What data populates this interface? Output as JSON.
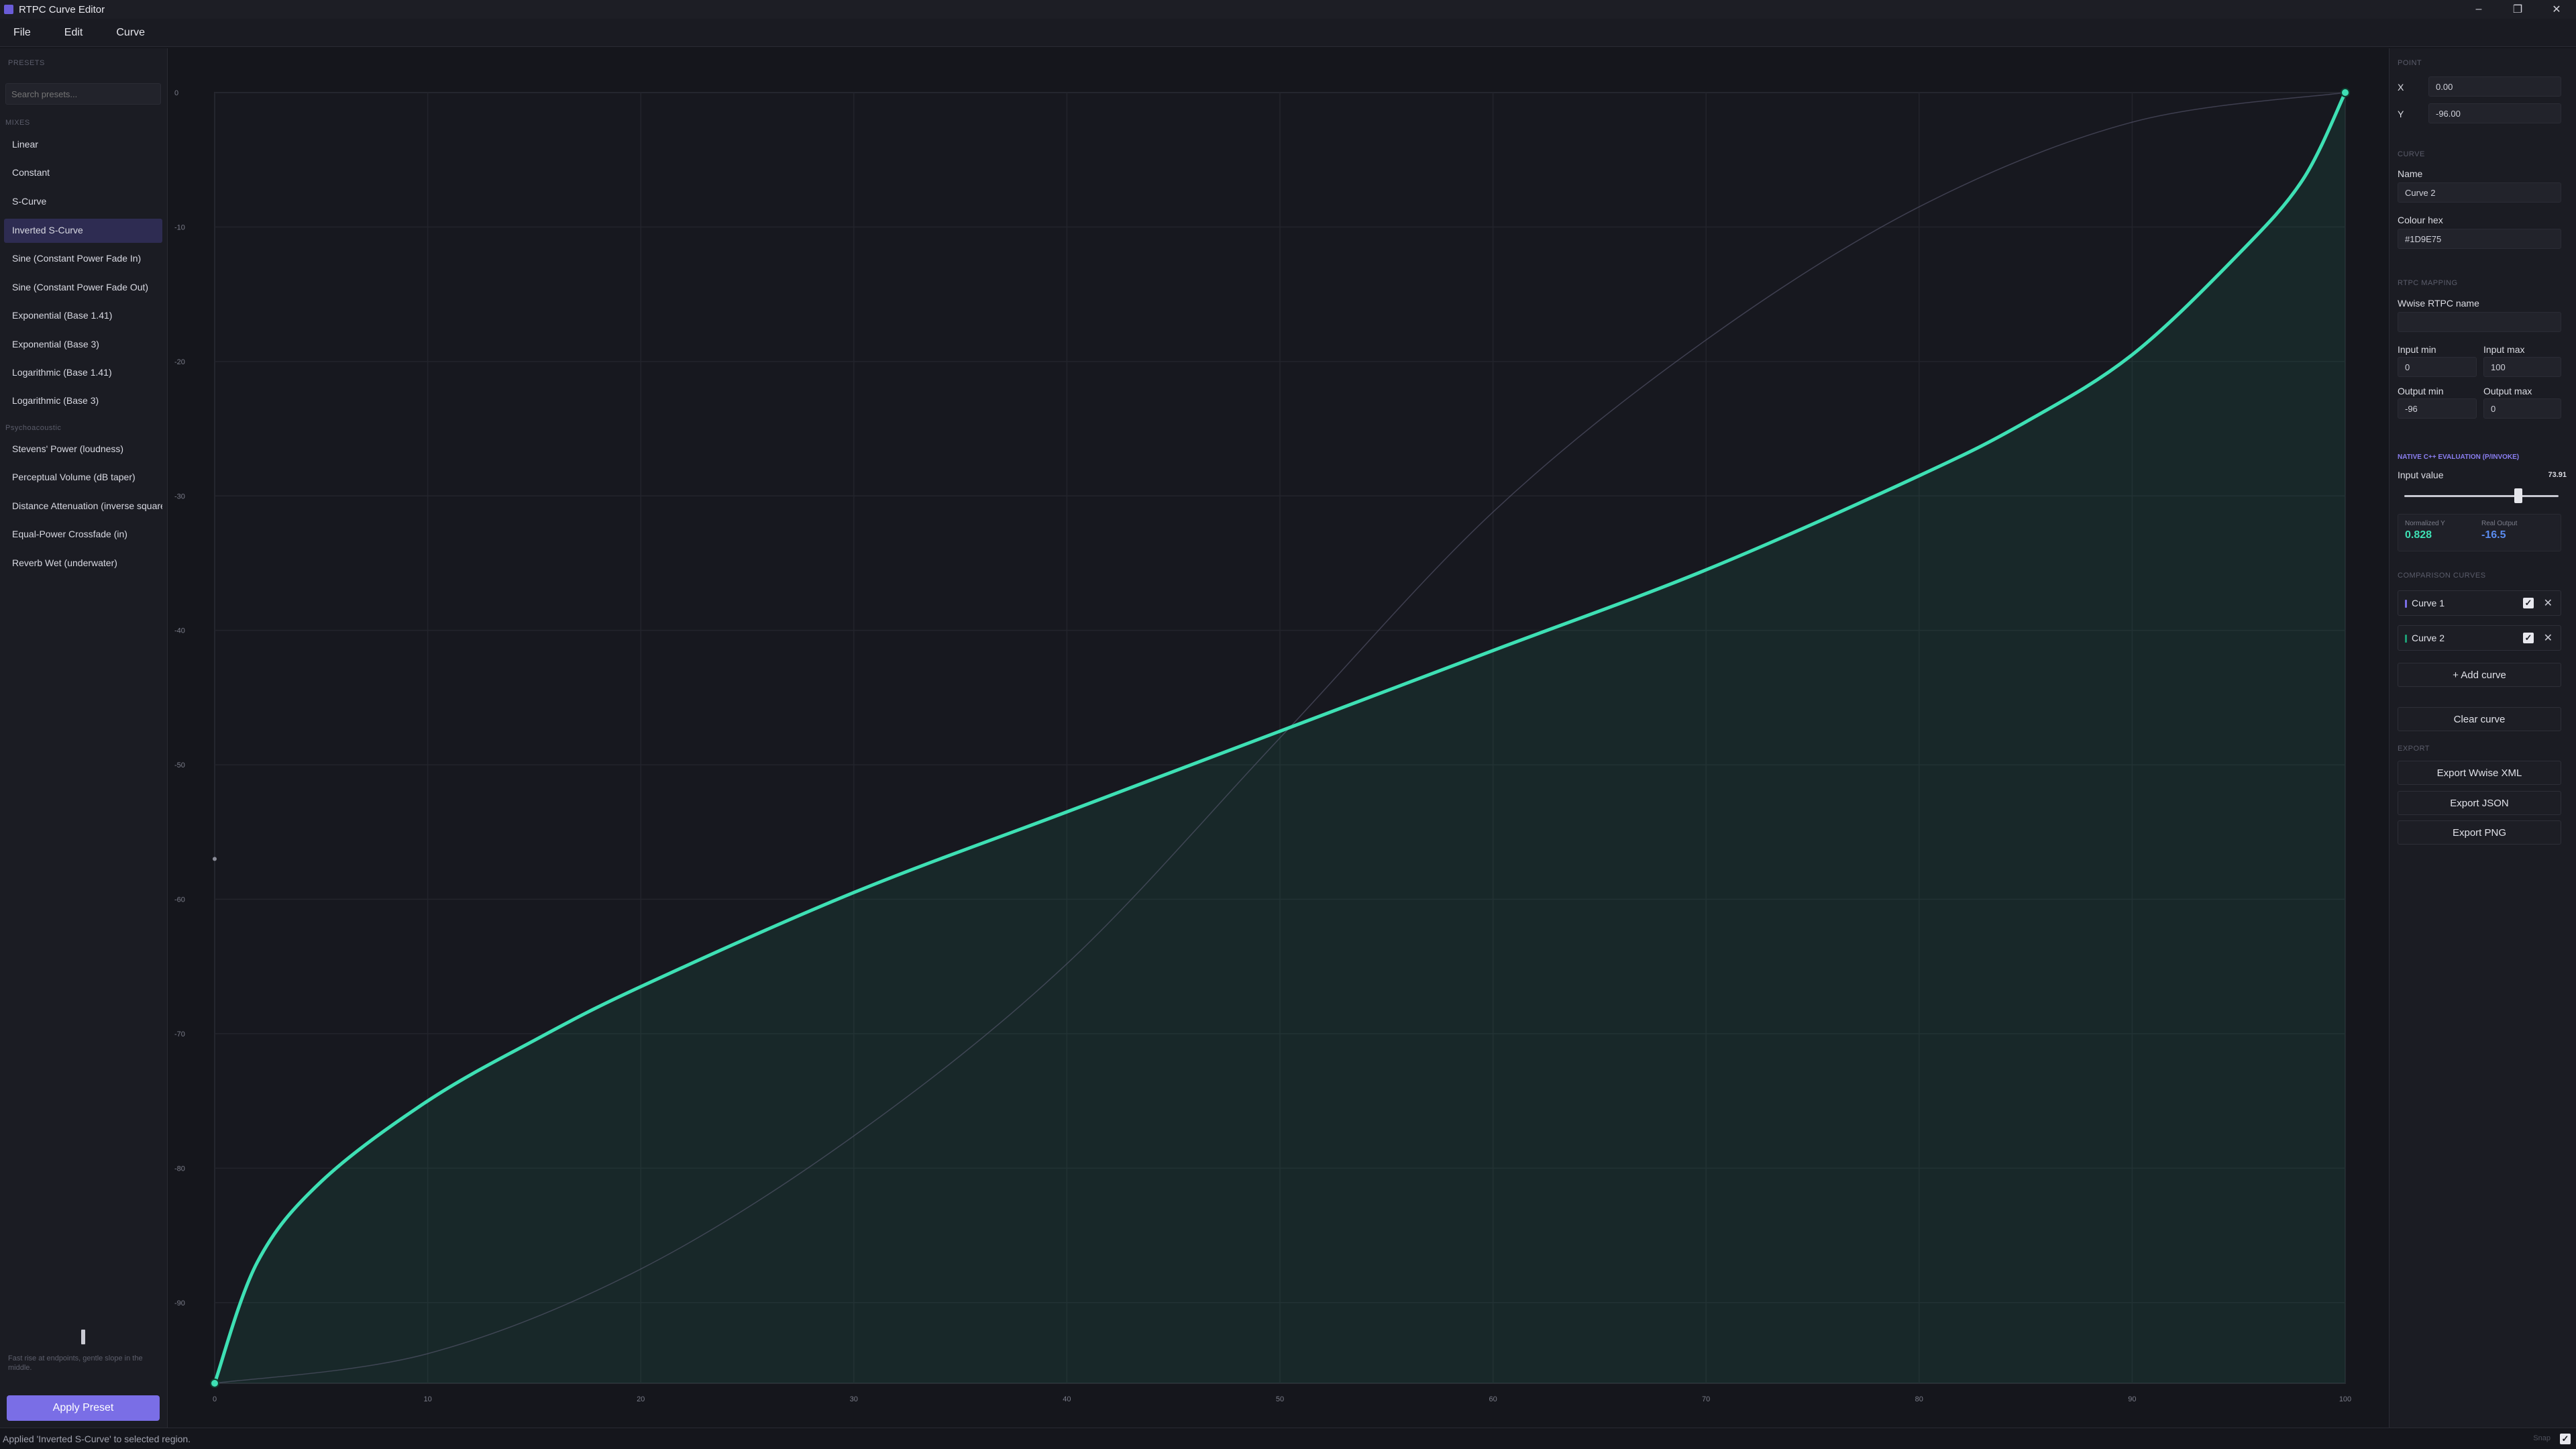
{
  "window": {
    "title": "RTPC Curve Editor",
    "minimize": "–",
    "restore": "❐",
    "close": "✕"
  },
  "menu": [
    "File",
    "Edit",
    "Curve"
  ],
  "left": {
    "section": "Presets",
    "search_placeholder": "Search presets...",
    "group1": "Mixes",
    "presets1": [
      "Linear",
      "Constant",
      "S-Curve",
      "Inverted S-Curve",
      "Sine (Constant Power Fade In)",
      "Sine (Constant Power Fade Out)",
      "Exponential (Base 1.41)",
      "Exponential (Base 3)",
      "Logarithmic (Base 1.41)",
      "Logarithmic (Base 3)"
    ],
    "group2": "Psychoacoustic",
    "presets2": [
      "Stevens' Power (loudness)",
      "Perceptual Volume (dB taper)",
      "Distance Attenuation (inverse square)",
      "Equal-Power Crossfade (in)",
      "Reverb Wet (underwater)"
    ],
    "active_preset": "Inverted S-Curve",
    "hint": "Fast rise at endpoints, gentle slope in the middle.",
    "apply": "Apply Preset"
  },
  "right": {
    "point_section": "Point",
    "x_label": "X",
    "x_value": "0.00",
    "y_label": "Y",
    "y_value": "-96.00",
    "curve_section": "Curve",
    "name_label": "Name",
    "name_value": "Curve 2",
    "colour_label": "Colour hex",
    "colour_value": "#1D9E75",
    "mapping_section": "RTPC Mapping",
    "wwise_label": "Wwise RTPC name",
    "wwise_value": "",
    "input_min_label": "Input min",
    "input_min": "0",
    "input_max_label": "Input max",
    "input_max": "100",
    "output_min_label": "Output min",
    "output_min": "-96",
    "output_max_label": "Output max",
    "output_max": "0",
    "eval_section": "Native C++ Evaluation (P/Invoke)",
    "input_value_label": "Input value",
    "input_value": "73.91",
    "input_value_fraction": 0.7391,
    "norm_label": "Normalized Y",
    "norm_value": "0.828",
    "real_label": "Real Output",
    "real_value": "-16.5",
    "comparison_section": "Comparison Curves",
    "curves": [
      {
        "name": "Curve 1",
        "color": "#7a6ee6"
      },
      {
        "name": "Curve 2",
        "color": "#1D9E75"
      }
    ],
    "check": "✓",
    "remove": "✕",
    "add_curve": "+ Add curve",
    "clear_curve": "Clear curve",
    "export_section": "Export",
    "export_xml": "Export Wwise XML",
    "export_json": "Export JSON",
    "export_png": "Export PNG"
  },
  "status": {
    "message": "Applied 'Inverted S-Curve' to selected region.",
    "snap_label": "Snap",
    "snap_check": "✓"
  },
  "chart_data": {
    "type": "line",
    "xlim": [
      0,
      100
    ],
    "ylim": [
      -96,
      0
    ],
    "x_ticks": [
      "0",
      "10",
      "20",
      "30",
      "40",
      "50",
      "60",
      "70",
      "80",
      "90",
      "100"
    ],
    "y_ticks": [
      "0",
      "-10",
      "-20",
      "-30",
      "-40",
      "-50",
      "-60",
      "-70",
      "-80",
      "-90"
    ],
    "grid": true,
    "series": [
      {
        "color": "#5a5a72",
        "x": [
          0,
          10,
          20,
          30,
          40,
          50,
          60,
          70,
          80,
          90,
          100
        ],
        "y": [
          -96,
          -93.8,
          -87.5,
          -77.6,
          -64.8,
          -48.0,
          -31.2,
          -18.4,
          -8.5,
          -2.2,
          0
        ]
      },
      {
        "color": "#3ee0b4",
        "fill": "#1D9E75",
        "x": [
          0,
          2,
          5,
          10,
          15,
          20,
          30,
          40,
          50,
          60,
          70,
          80,
          85,
          90,
          95,
          98,
          100
        ],
        "y": [
          -96,
          -87,
          -81,
          -75,
          -70.5,
          -66.5,
          -59.5,
          -53.5,
          -47.5,
          -41.5,
          -35.5,
          -28.5,
          -24.5,
          -19.5,
          -12,
          -6.5,
          0
        ]
      }
    ],
    "control_points": [
      [
        0,
        -96
      ],
      [
        100,
        0
      ]
    ],
    "left_marker": [
      0,
      -57
    ]
  }
}
